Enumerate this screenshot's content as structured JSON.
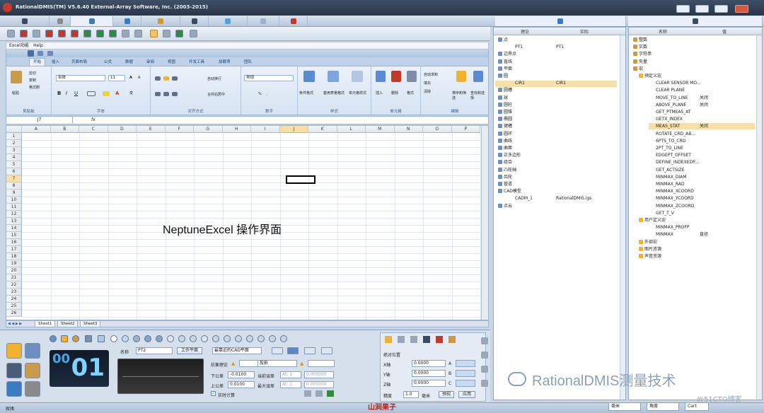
{
  "app": {
    "title": "RationalDMIS(TM) V5.6.40    External-Array Software, Inc. (2003-2015)"
  },
  "excel": {
    "menu": [
      "Excel功能",
      "Help"
    ],
    "ribbon_tabs": [
      "开始",
      "插入",
      "页面布局",
      "公式",
      "数据",
      "审阅",
      "视图",
      "开发工具",
      "加载项",
      "团队"
    ],
    "groups": {
      "clipboard": {
        "label": "剪贴板",
        "paste": "粘贴",
        "cut": "剪切",
        "copy": "复制",
        "format_painter": "格式刷"
      },
      "font": {
        "label": "字体",
        "font_name": "宋体",
        "font_size": "11",
        "bold": "B",
        "italic": "I",
        "underline": "U",
        "grow": "A",
        "shrink": "A",
        "font_color": "A",
        "wen": "变"
      },
      "alignment": {
        "label": "对齐方式",
        "wrap": "自动换行",
        "merge": "合并后居中"
      },
      "number": {
        "label": "数字",
        "format": "常规",
        "percent": "%",
        "comma": ","
      },
      "styles": {
        "label": "样式",
        "conditional": "条件格式",
        "table": "套用表格格式",
        "cell_styles": "单元格样式"
      },
      "cells": {
        "label": "单元格",
        "insert": "插入",
        "delete": "删除",
        "format": "格式"
      },
      "editing": {
        "label": "编辑",
        "autosum": "自动求和",
        "fill": "填充",
        "clear": "清除",
        "sort": "排序和筛选",
        "find": "查找和选择"
      }
    },
    "name_box": "J7",
    "fx": "fx",
    "columns": [
      "A",
      "B",
      "C",
      "D",
      "E",
      "F",
      "G",
      "H",
      "I",
      "J",
      "K",
      "L",
      "M",
      "N",
      "O",
      "P"
    ],
    "rows": [
      "1",
      "2",
      "3",
      "4",
      "5",
      "6",
      "7",
      "8",
      "9",
      "10",
      "11",
      "12",
      "13",
      "14",
      "15",
      "16",
      "17",
      "18",
      "19",
      "20",
      "21",
      "22",
      "23",
      "24",
      "25",
      "26"
    ],
    "sheets": [
      "Sheet1",
      "Sheet2",
      "Sheet3"
    ],
    "center_text": "NeptuneExcel 操作界面"
  },
  "bottom": {
    "counter_small": "00",
    "counter": "01",
    "name_label": "名称",
    "name_value": "PT2",
    "work_plane": "工作平面",
    "cad_plane": "最靠近的CAD平面",
    "touch_dev": "抗衡理论",
    "projection": "投影",
    "lower_tol_label": "下公差",
    "lower_tol": "-0.0100",
    "upper_tol_label": "上公差",
    "upper_tol": "0.0100",
    "current_err": "当前误差",
    "max_err": "最大误差",
    "at1": "At: 1",
    "at2": "At: 1",
    "zero1": "0.000000",
    "zero2": "0.000000",
    "realtime": "实时计算",
    "abs_pos": "绝对位置",
    "x_axis": "X轴",
    "y_axis": "Y轴",
    "z_axis": "Z轴",
    "x_val": "0.0000",
    "y_val": "0.0000",
    "z_val": "0.0000",
    "a_lbl": "A",
    "b_lbl": "B",
    "c_lbl": "C",
    "precision_label": "精度",
    "precision": "1.0",
    "unit": "毫米",
    "preview": "预视",
    "apply": "应用"
  },
  "status": {
    "left": "就绪",
    "brand": "山涧果子",
    "unit_dd": "毫米",
    "angle_dd": "角度",
    "cart_dd": "Cart"
  },
  "feature_panel": {
    "col_theory": "理论",
    "col_actual": "实际",
    "items": [
      {
        "label": "点",
        "actual": ""
      },
      {
        "label": "PT1",
        "actual": "PT1"
      },
      {
        "label": "边界点",
        "actual": ""
      },
      {
        "label": "直线",
        "actual": ""
      },
      {
        "label": "平面",
        "actual": ""
      },
      {
        "label": "圆",
        "actual": ""
      },
      {
        "label": "CIR1",
        "actual": "CIR1"
      },
      {
        "label": "圆槽",
        "actual": ""
      },
      {
        "label": "球",
        "actual": ""
      },
      {
        "label": "圆柱",
        "actual": ""
      },
      {
        "label": "圆锥",
        "actual": ""
      },
      {
        "label": "椭圆",
        "actual": ""
      },
      {
        "label": "键槽",
        "actual": ""
      },
      {
        "label": "圆环",
        "actual": ""
      },
      {
        "label": "曲线",
        "actual": ""
      },
      {
        "label": "曲面",
        "actual": ""
      },
      {
        "label": "正多边形",
        "actual": ""
      },
      {
        "label": "组合",
        "actual": ""
      },
      {
        "label": "凸轮轴",
        "actual": ""
      },
      {
        "label": "齿轮",
        "actual": ""
      },
      {
        "label": "管道",
        "actual": ""
      },
      {
        "label": "CAD模型",
        "actual": ""
      },
      {
        "label": "CADM_1",
        "actual": "RationalDMIS.igs"
      },
      {
        "label": "点云",
        "actual": ""
      }
    ]
  },
  "variable_panel": {
    "col_name": "名称",
    "col_value": "值",
    "items": [
      {
        "label": "整数",
        "value": ""
      },
      {
        "label": "实数",
        "value": ""
      },
      {
        "label": "字符串",
        "value": ""
      },
      {
        "label": "矢量",
        "value": ""
      },
      {
        "label": "宏",
        "value": ""
      },
      {
        "label": "预定义宏",
        "value": ""
      },
      {
        "label": "CLEAR SENSOR MO...",
        "value": ""
      },
      {
        "label": "CLEAR PLANE",
        "value": ""
      },
      {
        "label": "MOVE_TO_LINE",
        "value": "关闭"
      },
      {
        "label": "ABOVE_PLANE",
        "value": "关闭"
      },
      {
        "label": "GET_PTMEAS_AT",
        "value": ""
      },
      {
        "label": "GETX_INDEX",
        "value": ""
      },
      {
        "label": "MEAS_STAT",
        "value": "关闭"
      },
      {
        "label": "ROTATE_CRD_AB...",
        "value": ""
      },
      {
        "label": "6PTS_TO_CRD",
        "value": ""
      },
      {
        "label": "2PT_TO_LINE",
        "value": ""
      },
      {
        "label": "EDGEPT_OFFSET",
        "value": ""
      },
      {
        "label": "DEFINE_INDEXEDP...",
        "value": ""
      },
      {
        "label": "GET_ACTSIZE",
        "value": ""
      },
      {
        "label": "MINMAX_DIAM",
        "value": ""
      },
      {
        "label": "MINMAX_RAD",
        "value": ""
      },
      {
        "label": "MINMAX_XCOORD",
        "value": ""
      },
      {
        "label": "MINMAX_YCOORD",
        "value": ""
      },
      {
        "label": "MINMAX_ZCOORD",
        "value": ""
      },
      {
        "label": "GET_T_V",
        "value": ""
      },
      {
        "label": "用户定义宏",
        "value": ""
      },
      {
        "label": "MINMAX_PROFP",
        "value": ""
      },
      {
        "label": "MINMAX",
        "value": "直径"
      },
      {
        "label": "外部宏",
        "value": ""
      },
      {
        "label": "图片资源",
        "value": ""
      },
      {
        "label": "声音资源",
        "value": ""
      }
    ]
  },
  "watermark": {
    "text": "RationalDMIS测量技术",
    "blog": "@51CTO博客"
  }
}
